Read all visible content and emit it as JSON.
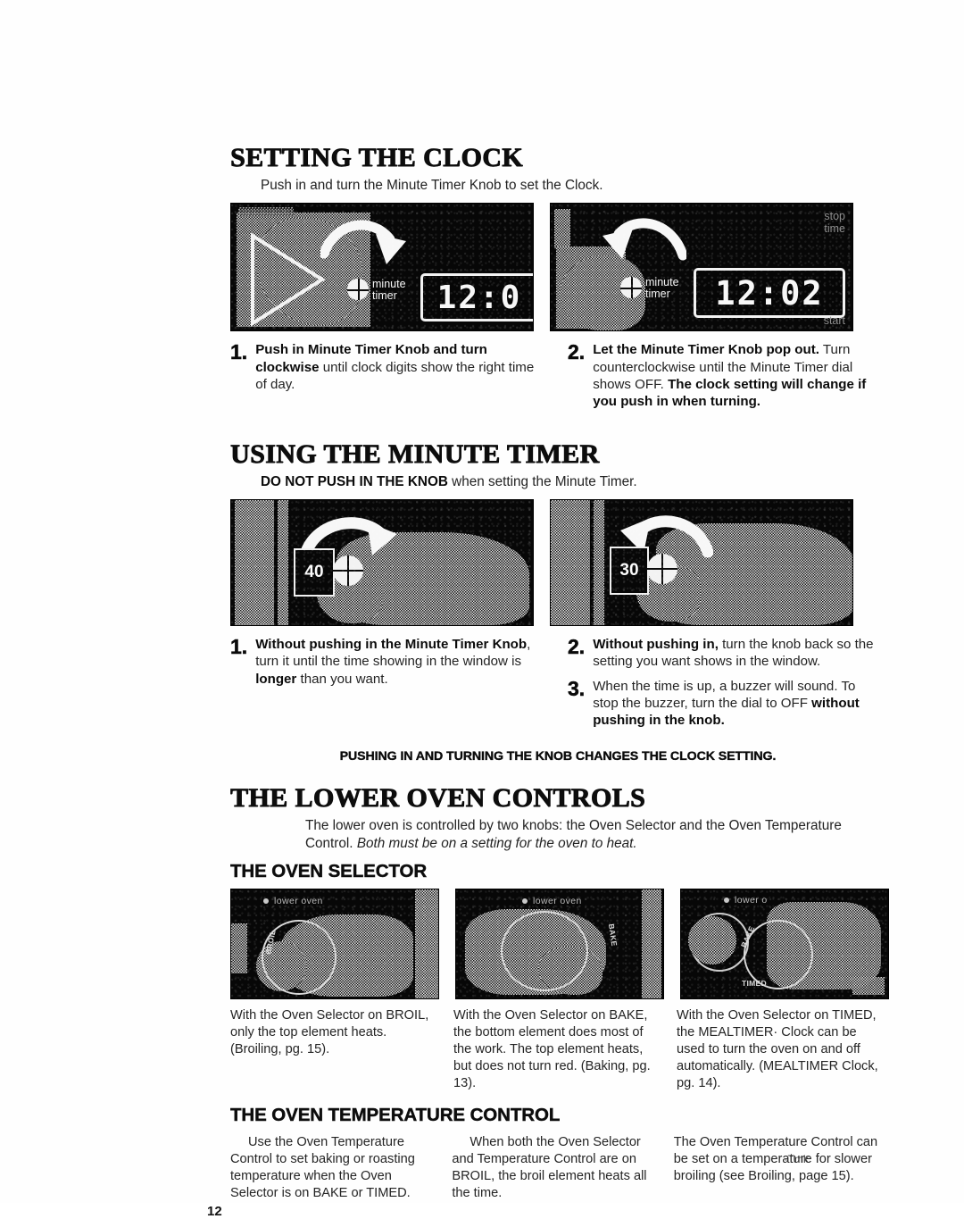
{
  "page": {
    "number": "12",
    "trademark_note": "·Tmk"
  },
  "sections": [
    {
      "id": "setting-the-clock",
      "title": "SETTING THE CLOCK",
      "lede": "Push in and turn the Minute Timer Knob to set the Clock.",
      "photos": [
        {
          "id": "clock-photo-1",
          "knob_label_line1": "minute",
          "knob_label_line2": "timer",
          "display_value": "12:0",
          "arrow": "curved-arrow-clockwise"
        },
        {
          "id": "clock-photo-2",
          "knob_label_line1": "minute",
          "knob_label_line2": "timer",
          "display_value": "12:02",
          "corner_top_line1": "stop",
          "corner_top_line2": "time",
          "corner_bottom": "start",
          "arrow": "curved-arrow-counterclockwise"
        }
      ],
      "steps": [
        {
          "num": "1.",
          "parts": [
            {
              "text": "Push in Minute Timer Knob and turn clockwise",
              "bold": true
            },
            {
              "text": " until clock digits show the right time of day.",
              "bold": false
            }
          ]
        },
        {
          "num": "2.",
          "parts": [
            {
              "text": "Let the Minute Timer Knob pop out.",
              "bold": true
            },
            {
              "text": " Turn counterclockwise until the Minute Timer dial shows OFF. ",
              "bold": false
            },
            {
              "text": "The clock setting will change if you push in when turning.",
              "bold": true
            }
          ]
        }
      ]
    },
    {
      "id": "using-the-minute-timer",
      "title": "USING THE MINUTE TIMER",
      "lede_bold": "DO NOT PUSH IN THE KNOB",
      "lede_rest": " when setting the Minute Timer.",
      "photos": [
        {
          "id": "timer-photo-1",
          "dial_value": "40",
          "arrow": "curved-arrow-clockwise"
        },
        {
          "id": "timer-photo-2",
          "dial_value": "30",
          "arrow": "curved-arrow-counterclockwise"
        }
      ],
      "steps_left": [
        {
          "num": "1.",
          "parts": [
            {
              "text": "Without pushing in the Minute Timer Knob",
              "bold": true
            },
            {
              "text": ", turn it until the time showing in the window is ",
              "bold": false
            },
            {
              "text": "longer",
              "bold": true
            },
            {
              "text": " than you want.",
              "bold": false
            }
          ]
        }
      ],
      "steps_right": [
        {
          "num": "2.",
          "parts": [
            {
              "text": "Without pushing in,",
              "bold": true
            },
            {
              "text": " turn the knob back so the setting you want shows in the window.",
              "bold": false
            }
          ]
        },
        {
          "num": "3.",
          "parts": [
            {
              "text": "When the time is up, a buzzer will sound. To stop the buzzer, turn the dial to OFF ",
              "bold": false
            },
            {
              "text": "without pushing in the knob.",
              "bold": true
            }
          ]
        }
      ],
      "banner": "PUSHING IN AND TURNING THE KNOB CHANGES THE CLOCK SETTING."
    },
    {
      "id": "the-lower-oven-controls",
      "title": "THE LOWER OVEN CONTROLS",
      "lede_plain": "The lower oven is controlled by two knobs: the Oven Selector and the Oven Temperature Control. ",
      "lede_italic": "Both must be on a setting for the oven to heat.",
      "subsections": [
        {
          "id": "the-oven-selector",
          "title": "THE OVEN SELECTOR",
          "photos": [
            {
              "id": "oven-photo-broil",
              "panel_label": "lower oven",
              "knob_word": "BROIL"
            },
            {
              "id": "oven-photo-bake",
              "panel_label": "lower oven",
              "knob_word": "BAKE"
            },
            {
              "id": "oven-photo-timed",
              "panel_label": "lower o",
              "knob_word": "TIMED",
              "knob_word_2": "BAKE"
            }
          ],
          "captions": [
            "With the Oven Selector on BROIL, only the top element heats. (Broiling, pg. 15).",
            "With the Oven Selector on BAKE, the bottom element does most of the work. The top element heats, but does not turn red. (Baking, pg. 13).",
            "With the Oven Selector on TIMED, the MEALTIMER· Clock can be used to turn the oven on and off automatically. (MEALTIMER Clock, pg. 14)."
          ]
        },
        {
          "id": "the-oven-temperature-control",
          "title": "THE OVEN TEMPERATURE CONTROL",
          "captions": [
            "Use the Oven Temperature Control to set baking or roasting temperature when the Oven Selector is on BAKE or TIMED.",
            "When both the Oven Selector and Temperature Control are on BROIL, the broil element heats all the time.",
            "The Oven Temperature Control can be set on a temperature for slower broiling (see Broiling, page 15)."
          ]
        }
      ]
    }
  ]
}
